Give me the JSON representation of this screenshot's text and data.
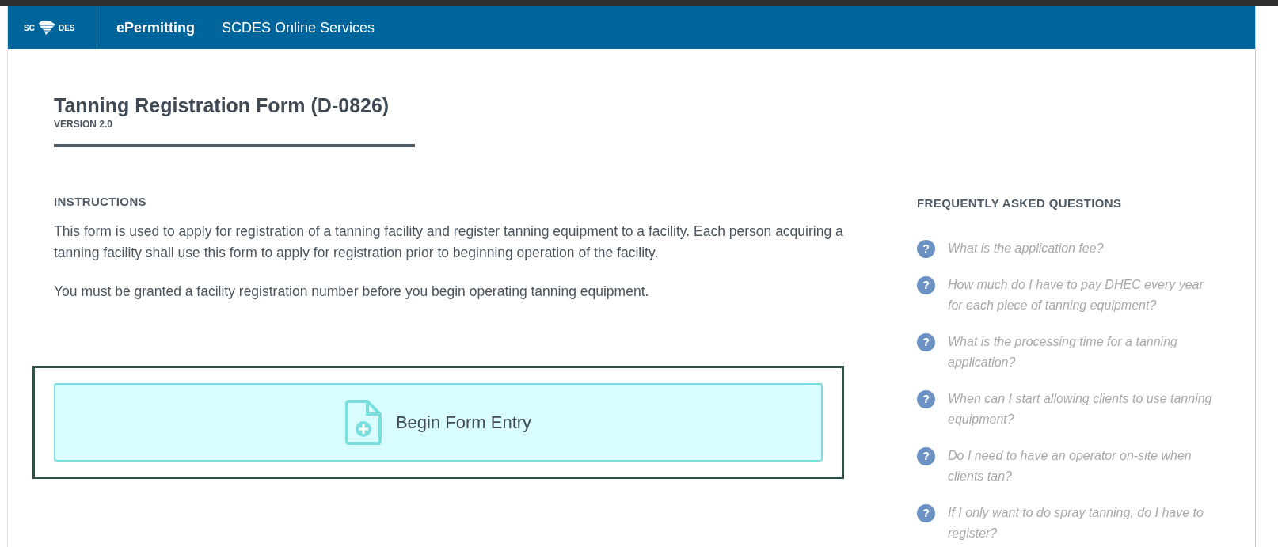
{
  "nav": {
    "logo_left": "SC",
    "logo_right": "DES",
    "app": "ePermitting",
    "link": "SCDES Online Services"
  },
  "form": {
    "title": "Tanning Registration Form (D-0826)",
    "version": "VERSION 2.0"
  },
  "instructions": {
    "heading": "INSTRUCTIONS",
    "paragraphs": [
      "This form is used to apply for registration of a tanning facility and register tanning equipment to a facility. Each person acquiring a tanning facility shall use this form to apply for registration prior to beginning operation of the facility.",
      "You must be granted a facility registration number before you begin operating tanning equipment."
    ]
  },
  "begin_button": {
    "label": "Begin Form Entry"
  },
  "faq": {
    "heading": "FREQUENTLY ASKED QUESTIONS",
    "items": [
      {
        "icon": "?",
        "question": "What is the application fee?"
      },
      {
        "icon": "?",
        "question": "How much do I have to pay DHEC every year for each piece of tanning equipment?"
      },
      {
        "icon": "?",
        "question": "What is the processing time for a tanning application?"
      },
      {
        "icon": "?",
        "question": "When can I start allowing clients to use tanning equipment?"
      },
      {
        "icon": "?",
        "question": "Do I need to have an operator on-site when clients tan?"
      },
      {
        "icon": "?",
        "question": "If I only want to do spray tanning, do I have to register?"
      }
    ]
  }
}
